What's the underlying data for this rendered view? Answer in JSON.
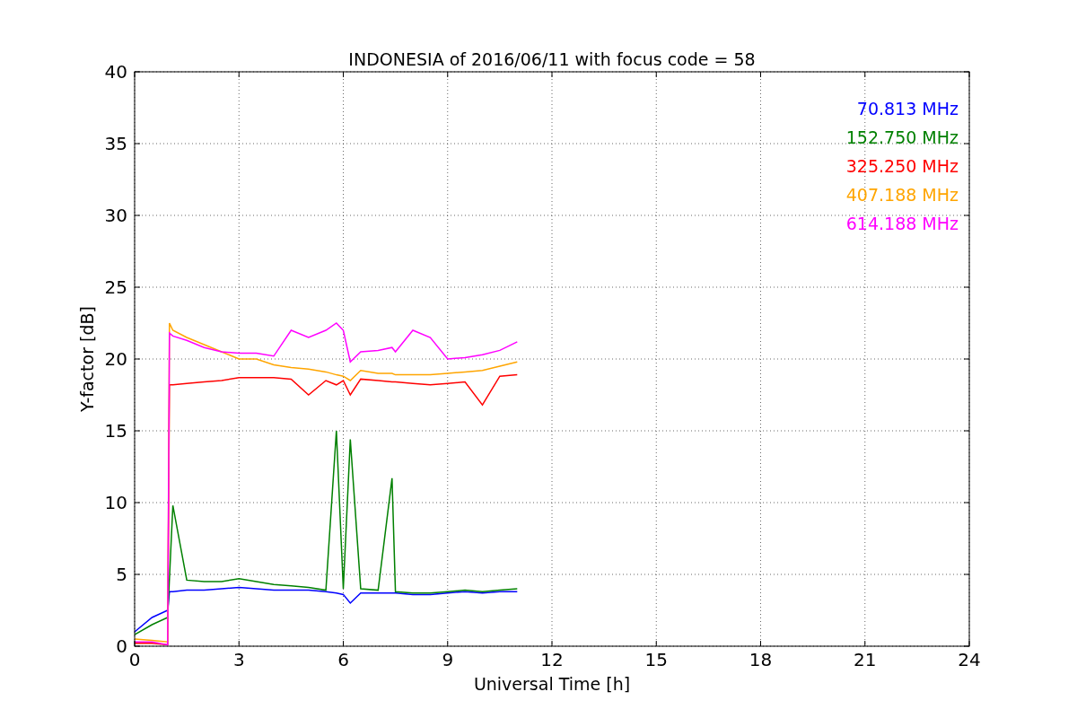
{
  "chart_data": {
    "type": "line",
    "title": "INDONESIA of 2016/06/11 with focus code = 58",
    "xlabel": "Universal Time [h]",
    "ylabel": "Y-factor [dB]",
    "x": [
      0,
      0.5,
      0.95,
      1,
      1.1,
      1.5,
      2,
      2.5,
      3,
      3.5,
      4,
      4.5,
      5,
      5.5,
      5.8,
      6,
      6.2,
      6.5,
      7,
      7.4,
      7.5,
      8,
      8.5,
      9,
      9.5,
      10,
      10.5,
      11
    ],
    "series": [
      {
        "name": "70.813 MHz",
        "color": "#0000ff",
        "values": [
          1.0,
          2.0,
          2.5,
          3.8,
          3.8,
          3.9,
          3.9,
          4.0,
          4.1,
          4.0,
          3.9,
          3.9,
          3.9,
          3.8,
          3.7,
          3.6,
          3.0,
          3.7,
          3.7,
          3.7,
          3.7,
          3.6,
          3.6,
          3.7,
          3.8,
          3.7,
          3.8,
          3.8
        ]
      },
      {
        "name": "152.750 MHz",
        "color": "#008000",
        "values": [
          0.8,
          1.5,
          2.0,
          4.7,
          9.8,
          4.6,
          4.5,
          4.5,
          4.7,
          4.5,
          4.3,
          4.2,
          4.1,
          3.9,
          15.0,
          4.0,
          14.4,
          4.0,
          3.9,
          11.7,
          3.8,
          3.7,
          3.7,
          3.8,
          3.9,
          3.8,
          3.9,
          4.0
        ]
      },
      {
        "name": "325.250 MHz",
        "color": "#ff0000",
        "values": [
          0.2,
          0.2,
          0.1,
          18.2,
          18.2,
          18.3,
          18.4,
          18.5,
          18.7,
          18.7,
          18.7,
          18.6,
          17.5,
          18.5,
          18.2,
          18.5,
          17.5,
          18.6,
          18.5,
          18.4,
          18.4,
          18.3,
          18.2,
          18.3,
          18.4,
          16.8,
          18.8,
          18.9
        ]
      },
      {
        "name": "407.188 MHz",
        "color": "#ffa500",
        "values": [
          0.5,
          0.4,
          0.3,
          22.5,
          22.0,
          21.5,
          21.0,
          20.5,
          20.0,
          20.0,
          19.6,
          19.4,
          19.3,
          19.1,
          18.9,
          18.8,
          18.5,
          19.2,
          19.0,
          19.0,
          18.9,
          18.9,
          18.9,
          19.0,
          19.1,
          19.2,
          19.5,
          19.8
        ]
      },
      {
        "name": "614.188 MHz",
        "color": "#ff00ff",
        "values": [
          0.3,
          0.3,
          0.1,
          21.8,
          21.6,
          21.3,
          20.8,
          20.5,
          20.4,
          20.4,
          20.2,
          22.0,
          21.5,
          22.0,
          22.5,
          22.0,
          19.8,
          20.5,
          20.6,
          20.8,
          20.5,
          22.0,
          21.5,
          20.0,
          20.1,
          20.3,
          20.6,
          21.2
        ]
      }
    ],
    "xlim": [
      0,
      24
    ],
    "ylim": [
      0,
      40
    ],
    "xticks": [
      0,
      3,
      6,
      9,
      12,
      15,
      18,
      21,
      24
    ],
    "yticks": [
      0,
      5,
      10,
      15,
      20,
      25,
      30,
      35,
      40
    ],
    "grid": true
  }
}
